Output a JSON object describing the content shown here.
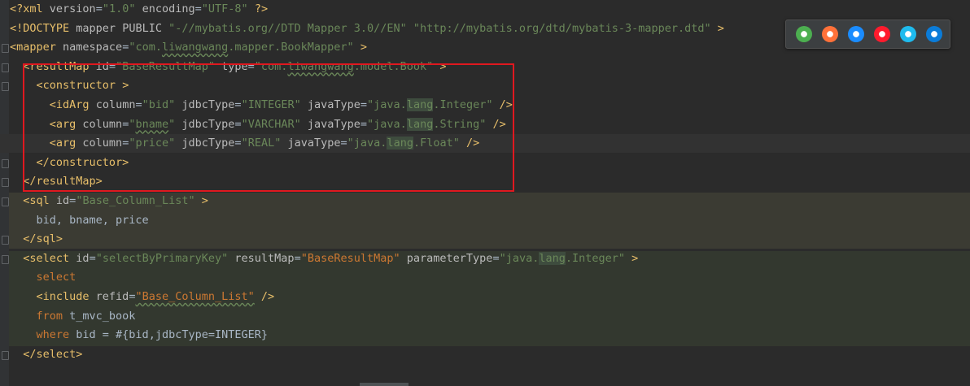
{
  "editor": {
    "lines": [
      [
        [
          "tag",
          "<?xml "
        ],
        [
          "attr",
          "version"
        ],
        [
          "plain",
          "="
        ],
        [
          "str",
          "\"1.0\""
        ],
        [
          "plain",
          " "
        ],
        [
          "attr",
          "encoding"
        ],
        [
          "plain",
          "="
        ],
        [
          "str",
          "\"UTF-8\""
        ],
        [
          "plain",
          " "
        ],
        [
          "tag",
          "?>"
        ]
      ],
      [
        [
          "tag",
          "<!DOCTYPE "
        ],
        [
          "attr",
          "mapper"
        ],
        [
          "plain",
          " "
        ],
        [
          "attr",
          "PUBLIC"
        ],
        [
          "plain",
          " "
        ],
        [
          "str",
          "\"-//mybatis.org//DTD Mapper 3.0//EN\""
        ],
        [
          "plain",
          " "
        ],
        [
          "str",
          "\"http://mybatis.org/dtd/mybatis-3-mapper.dtd\""
        ],
        [
          "plain",
          " "
        ],
        [
          "tag",
          ">"
        ]
      ],
      [
        [
          "tag",
          "<mapper "
        ],
        [
          "attr",
          "namespace"
        ],
        [
          "plain",
          "="
        ],
        [
          "str",
          "\"com."
        ],
        [
          "strul",
          "liwangwang"
        ],
        [
          "str",
          ".mapper.BookMapper\""
        ],
        [
          "plain",
          " "
        ],
        [
          "tag",
          ">"
        ]
      ],
      [
        [
          "plain",
          "  "
        ],
        [
          "tag",
          "<resultMap "
        ],
        [
          "attr",
          "id"
        ],
        [
          "plain",
          "="
        ],
        [
          "str",
          "\"BaseResultMap\""
        ],
        [
          "plain",
          " "
        ],
        [
          "attr",
          "type"
        ],
        [
          "plain",
          "="
        ],
        [
          "str",
          "\"com."
        ],
        [
          "strul",
          "liwangwang"
        ],
        [
          "str",
          ".model.Book\""
        ],
        [
          "plain",
          " "
        ],
        [
          "tag",
          ">"
        ]
      ],
      [
        [
          "plain",
          "    "
        ],
        [
          "tag",
          "<constructor "
        ],
        [
          "tag",
          ">"
        ]
      ],
      [
        [
          "plain",
          "      "
        ],
        [
          "tag",
          "<idArg "
        ],
        [
          "attr",
          "column"
        ],
        [
          "plain",
          "="
        ],
        [
          "str",
          "\"bid\""
        ],
        [
          "plain",
          " "
        ],
        [
          "attr",
          "jdbcType"
        ],
        [
          "plain",
          "="
        ],
        [
          "str",
          "\"INTEGER\""
        ],
        [
          "plain",
          " "
        ],
        [
          "attr",
          "javaType"
        ],
        [
          "plain",
          "="
        ],
        [
          "str",
          "\"java."
        ],
        [
          "strhl",
          "lang"
        ],
        [
          "str",
          ".Integer\""
        ],
        [
          "plain",
          " "
        ],
        [
          "tag",
          "/>"
        ]
      ],
      [
        [
          "plain",
          "      "
        ],
        [
          "tag",
          "<arg "
        ],
        [
          "attr",
          "column"
        ],
        [
          "plain",
          "="
        ],
        [
          "str",
          "\""
        ],
        [
          "strul",
          "bname"
        ],
        [
          "str",
          "\""
        ],
        [
          "plain",
          " "
        ],
        [
          "attr",
          "jdbcType"
        ],
        [
          "plain",
          "="
        ],
        [
          "str",
          "\"VARCHAR\""
        ],
        [
          "plain",
          " "
        ],
        [
          "attr",
          "javaType"
        ],
        [
          "plain",
          "="
        ],
        [
          "str",
          "\"java."
        ],
        [
          "strhl",
          "lang"
        ],
        [
          "str",
          ".String\""
        ],
        [
          "plain",
          " "
        ],
        [
          "tag",
          "/>"
        ]
      ],
      [
        [
          "plain",
          "      "
        ],
        [
          "tag",
          "<arg "
        ],
        [
          "attr",
          "column"
        ],
        [
          "plain",
          "="
        ],
        [
          "str",
          "\"price\""
        ],
        [
          "plain",
          " "
        ],
        [
          "attr",
          "jdbcType"
        ],
        [
          "plain",
          "="
        ],
        [
          "str",
          "\"REAL\""
        ],
        [
          "plain",
          " "
        ],
        [
          "attr",
          "javaType"
        ],
        [
          "plain",
          "="
        ],
        [
          "str",
          "\"java."
        ],
        [
          "strhl",
          "lang"
        ],
        [
          "str",
          ".Float\""
        ],
        [
          "plain",
          " "
        ],
        [
          "tag",
          "/>"
        ]
      ],
      [
        [
          "plain",
          "    "
        ],
        [
          "tag",
          "</constructor>"
        ]
      ],
      [
        [
          "plain",
          "  "
        ],
        [
          "tag",
          "</resultMap>"
        ]
      ],
      [
        [
          "plain",
          "  "
        ],
        [
          "tag",
          "<sql "
        ],
        [
          "attr",
          "id"
        ],
        [
          "plain",
          "="
        ],
        [
          "str",
          "\"Base_Column_List\""
        ],
        [
          "plain",
          " "
        ],
        [
          "tag",
          ">"
        ]
      ],
      [
        [
          "plain",
          "    "
        ],
        [
          "text",
          "bid, bname, price"
        ]
      ],
      [
        [
          "plain",
          "  "
        ],
        [
          "tag",
          "</sql>"
        ]
      ],
      [
        [
          "plain",
          "  "
        ],
        [
          "tag",
          "<select "
        ],
        [
          "attr",
          "id"
        ],
        [
          "plain",
          "="
        ],
        [
          "str",
          "\"selectByPrimaryKey\""
        ],
        [
          "plain",
          " "
        ],
        [
          "attr",
          "resultMap"
        ],
        [
          "plain",
          "="
        ],
        [
          "sqlkw",
          "\"BaseResultMap\""
        ],
        [
          "plain",
          " "
        ],
        [
          "attr",
          "parameterType"
        ],
        [
          "plain",
          "="
        ],
        [
          "str",
          "\"java."
        ],
        [
          "strhl",
          "lang"
        ],
        [
          "str",
          ".Integer\""
        ],
        [
          "plain",
          " "
        ],
        [
          "tag",
          ">"
        ]
      ],
      [
        [
          "plain",
          "    "
        ],
        [
          "sqlkw",
          "select"
        ]
      ],
      [
        [
          "plain",
          "    "
        ],
        [
          "tag",
          "<include "
        ],
        [
          "attr",
          "refid"
        ],
        [
          "plain",
          "="
        ],
        [
          "sqlkwul",
          "\"Base_Column_List\""
        ],
        [
          "plain",
          " "
        ],
        [
          "tag",
          "/>"
        ]
      ],
      [
        [
          "plain",
          "    "
        ],
        [
          "sqlkw",
          "from"
        ],
        [
          "text",
          " t_mvc_book"
        ]
      ],
      [
        [
          "plain",
          "    "
        ],
        [
          "sqlkw",
          "where"
        ],
        [
          "text",
          " bid = #{bid,jdbcType=INTEGER}"
        ]
      ],
      [
        [
          "plain",
          "  "
        ],
        [
          "tag",
          "</select>"
        ]
      ]
    ],
    "caret_line": 7
  },
  "browser_popup": {
    "browsers": [
      {
        "name": "Chrome",
        "icon": "chrome-icon",
        "color": "#4caf50"
      },
      {
        "name": "Firefox",
        "icon": "firefox-icon",
        "color": "#ff7139"
      },
      {
        "name": "Safari",
        "icon": "safari-icon",
        "color": "#1a8cff"
      },
      {
        "name": "Opera",
        "icon": "opera-icon",
        "color": "#ff1b2d"
      },
      {
        "name": "Internet Explorer",
        "icon": "ie-icon",
        "color": "#1ebbee"
      },
      {
        "name": "Edge",
        "icon": "edge-icon",
        "color": "#0a7cd9"
      }
    ]
  },
  "colors": {
    "background": "#2b2b2b",
    "tag": "#e8bf6a",
    "attribute": "#bababa",
    "string": "#6a8759",
    "sql_keyword": "#cc7832",
    "text": "#a9b7c6",
    "highlight_box": "#e0181f"
  }
}
